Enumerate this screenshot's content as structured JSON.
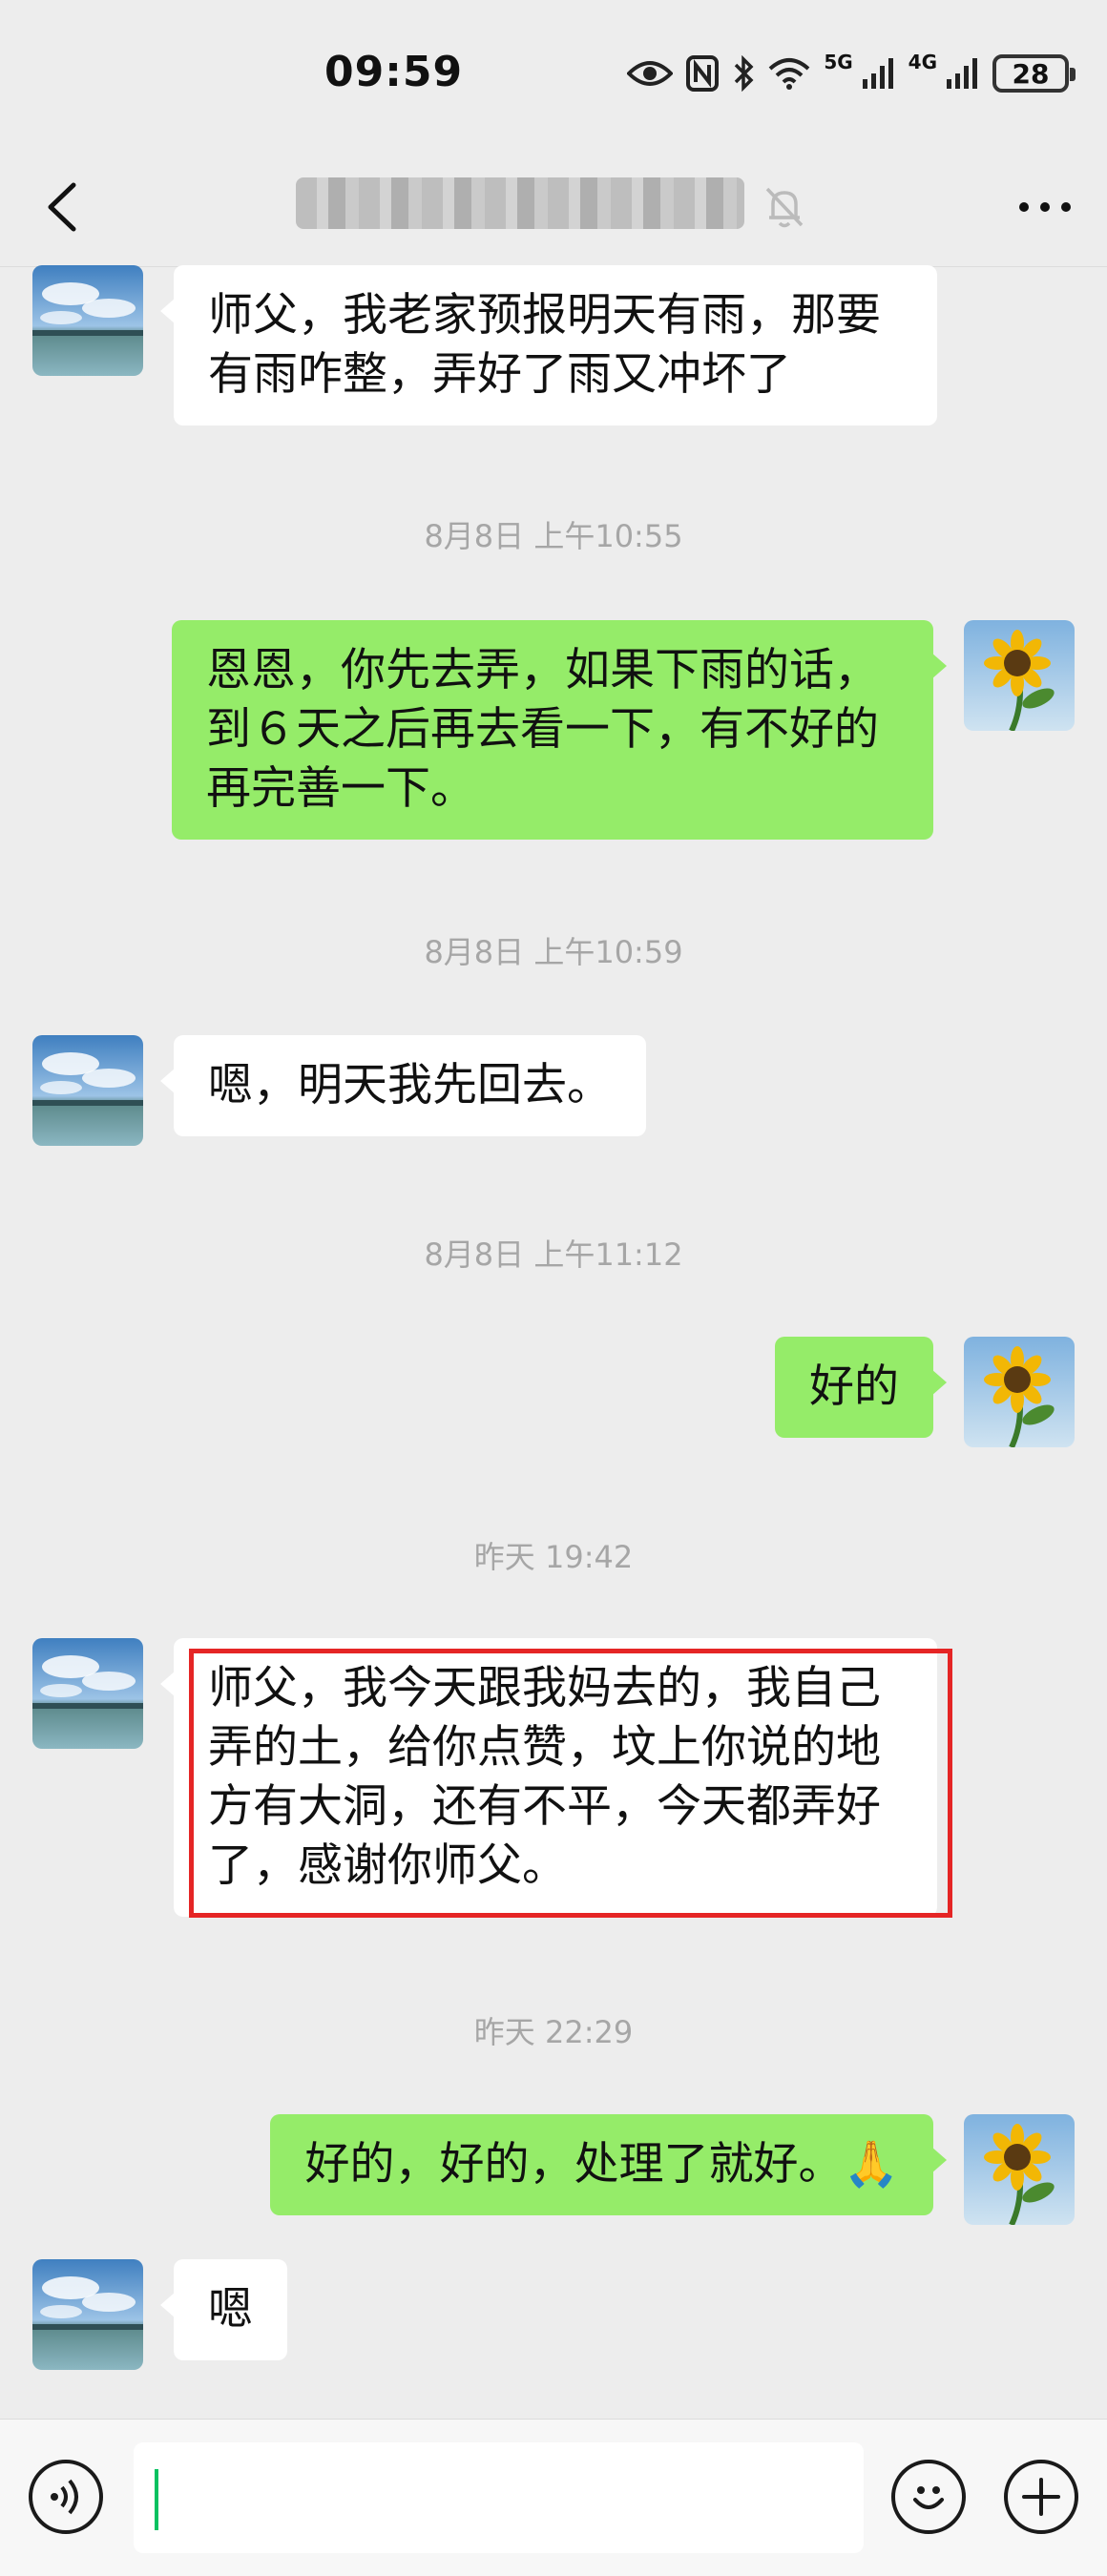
{
  "status_bar": {
    "time": "09:59",
    "battery": "28",
    "signal1_label": "5G",
    "signal2_label": "4G",
    "icons": [
      "eye-icon",
      "nfc-icon",
      "bluetooth-icon",
      "wifi-icon",
      "signal-5g-icon",
      "signal-4g-icon",
      "battery-icon"
    ]
  },
  "header": {
    "back_icon": "chevron-left-icon",
    "title_obscured": true,
    "mute_icon": "bell-muted-icon",
    "more_icon": "more-dots-icon"
  },
  "messages": [
    {
      "type": "message",
      "side": "in",
      "text": "师父，我老家预报明天有雨，那要有雨咋整，弄好了雨又冲坏了"
    },
    {
      "type": "timestamp",
      "text": "8月8日 上午10:55"
    },
    {
      "type": "message",
      "side": "out",
      "text": "恩恩，你先去弄，如果下雨的话，到６天之后再去看一下，有不好的再完善一下。"
    },
    {
      "type": "timestamp",
      "text": "8月8日 上午10:59"
    },
    {
      "type": "message",
      "side": "in",
      "text": "嗯，明天我先回去。"
    },
    {
      "type": "timestamp",
      "text": "8月8日 上午11:12"
    },
    {
      "type": "message",
      "side": "out",
      "text": "好的"
    },
    {
      "type": "timestamp",
      "text": "昨天 19:42"
    },
    {
      "type": "message",
      "side": "in",
      "text": "师父，我今天跟我妈去的，我自己弄的土，给你点赞，坟上你说的地方有大洞，还有不平，今天都弄好了，感谢你师父。",
      "highlighted": true
    },
    {
      "type": "timestamp",
      "text": "昨天 22:29"
    },
    {
      "type": "message",
      "side": "out",
      "text": "好的，好的，处理了就好。🙏"
    },
    {
      "type": "message",
      "side": "in",
      "text": "嗯"
    }
  ],
  "input_bar": {
    "voice_icon": "voice-icon",
    "input_value": "",
    "emoji_icon": "emoji-icon",
    "plus_icon": "plus-icon"
  },
  "colors": {
    "background": "#ededed",
    "outgoing_bubble": "#95ec69",
    "incoming_bubble": "#ffffff",
    "timestamp_text": "#a6a6a6",
    "highlight_border": "#e52525",
    "cursor": "#07c160"
  }
}
